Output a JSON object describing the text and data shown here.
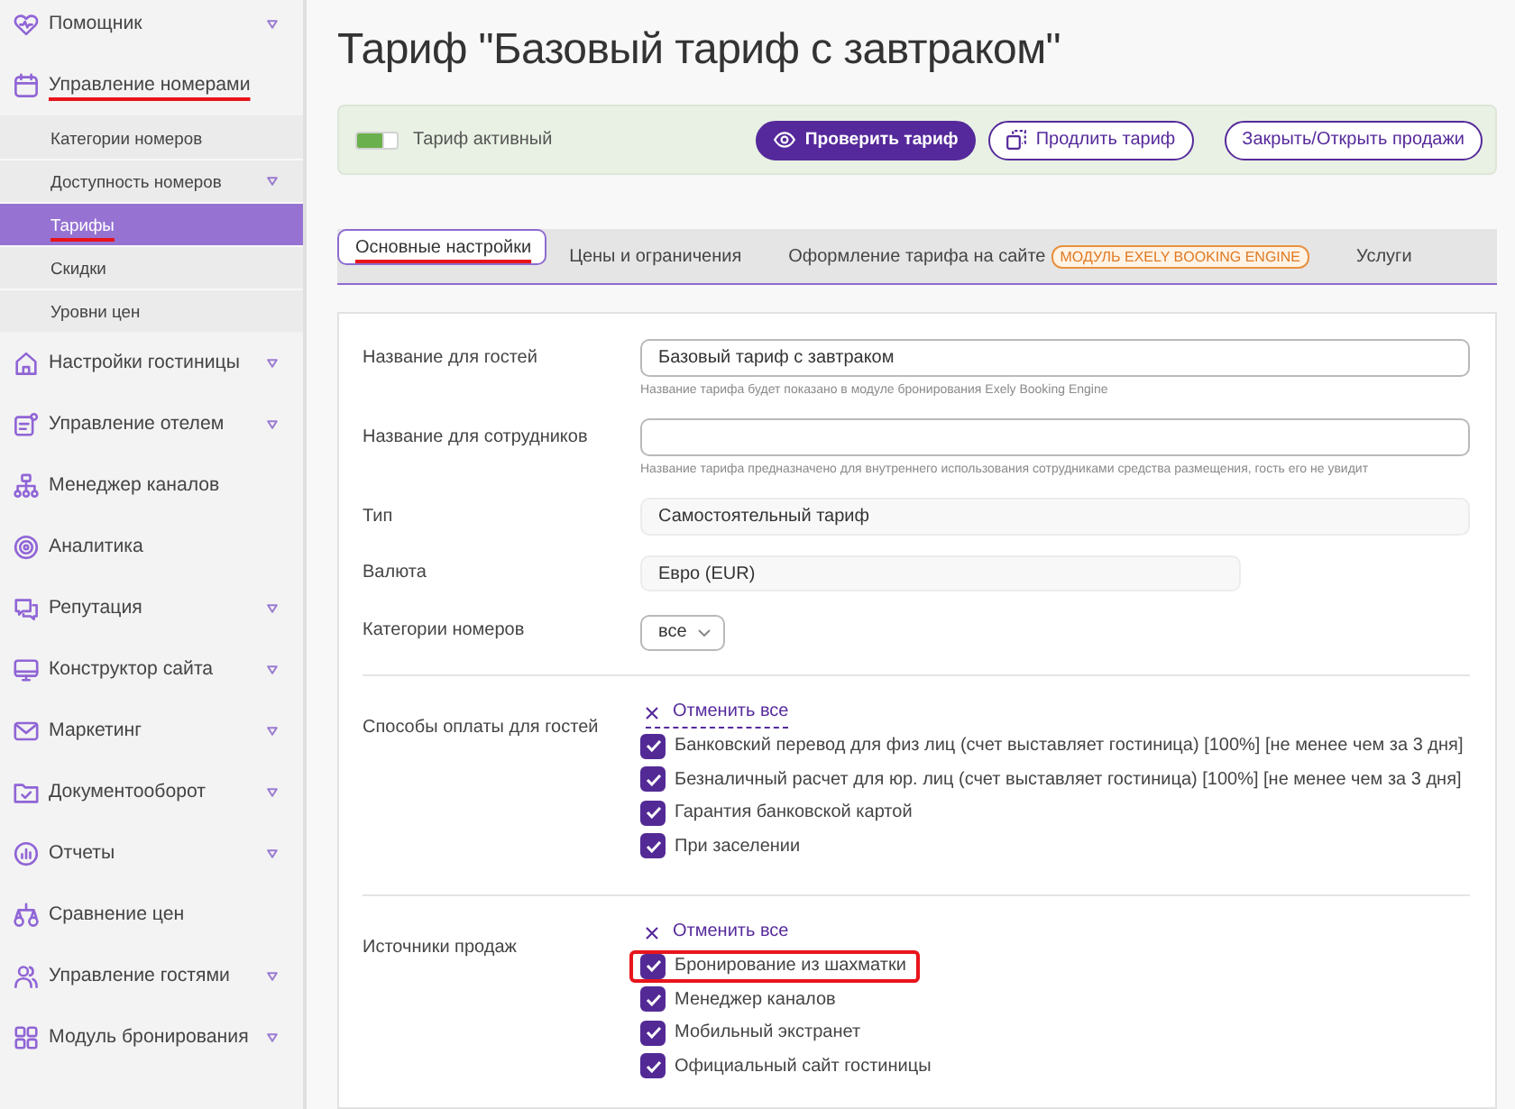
{
  "sidebar": {
    "items": [
      {
        "label": "Помощник",
        "caret": true,
        "highlighted": false
      },
      {
        "label": "Управление номерами",
        "caret": false,
        "highlighted": true,
        "children": [
          {
            "label": "Категории номеров",
            "caret": false,
            "selected": false,
            "highlighted": false
          },
          {
            "label": "Доступность номеров",
            "caret": true,
            "selected": false,
            "highlighted": false
          },
          {
            "label": "Тарифы",
            "caret": false,
            "selected": true,
            "highlighted": true
          },
          {
            "label": "Скидки",
            "caret": false,
            "selected": false,
            "highlighted": false
          },
          {
            "label": "Уровни цен",
            "caret": false,
            "selected": false,
            "highlighted": false
          }
        ]
      },
      {
        "label": "Настройки гостиницы",
        "caret": true,
        "highlighted": false
      },
      {
        "label": "Управление отелем",
        "caret": true,
        "highlighted": false
      },
      {
        "label": "Менеджер каналов",
        "caret": false,
        "highlighted": false
      },
      {
        "label": "Аналитика",
        "caret": false,
        "highlighted": false
      },
      {
        "label": "Репутация",
        "caret": true,
        "highlighted": false
      },
      {
        "label": "Конструктор сайта",
        "caret": true,
        "highlighted": false
      },
      {
        "label": "Маркетинг",
        "caret": true,
        "highlighted": false
      },
      {
        "label": "Документооборот",
        "caret": true,
        "highlighted": false
      },
      {
        "label": "Отчеты",
        "caret": true,
        "highlighted": false
      },
      {
        "label": "Сравнение цен",
        "caret": false,
        "highlighted": false
      },
      {
        "label": "Управление гостями",
        "caret": true,
        "highlighted": false
      },
      {
        "label": "Модуль бронирования",
        "caret": true,
        "highlighted": false
      }
    ]
  },
  "page": {
    "title": "Тариф \"Базовый тариф с завтраком\""
  },
  "action_bar": {
    "toggle": {
      "label": "Тариф активный",
      "on": true
    },
    "buttons": [
      {
        "label": "Проверить тариф",
        "kind": "primary"
      },
      {
        "label": "Продлить тариф",
        "kind": "outline"
      },
      {
        "label": "Закрыть/Открыть продажи",
        "kind": "outline"
      }
    ]
  },
  "tabs": [
    {
      "label": "Основные настройки",
      "selected": true,
      "highlighted": true
    },
    {
      "label": "Цены и ограничения",
      "selected": false,
      "highlighted": false
    },
    {
      "label": "Оформление тарифа на сайте",
      "badge": "МОДУЛЬ EXELY BOOKING ENGINE",
      "selected": false,
      "highlighted": false
    },
    {
      "label": "Услуги",
      "selected": false,
      "highlighted": false
    }
  ],
  "form": {
    "fields": [
      {
        "kind": "input",
        "label": "Название для гостей",
        "value": "Базовый тариф с завтраком",
        "hint": "Название тарифа будет показано в модуле бронирования Exely Booking Engine"
      },
      {
        "kind": "input",
        "label": "Название для сотрудников",
        "hint": "Название тарифа предназначено для внутреннего использования сотрудниками средства размещения, гость его не увидит"
      },
      {
        "kind": "display",
        "label": "Тип",
        "value": "Самостоятельный тариф"
      },
      {
        "kind": "compact",
        "label": "Валюта",
        "value": "Евро (EUR)"
      },
      {
        "kind": "select",
        "label": "Категории номеров",
        "value": "все"
      }
    ],
    "sections": [
      {
        "label": "Способы оплаты для гостей",
        "cancel_all": {
          "label": "Отменить все",
          "focused": true
        },
        "options": [
          {
            "label": "Банковский перевод для физ лиц (счет выставляет гостиница) [100%] [не менее чем за 3 дня]",
            "checked": true,
            "highlighted": false
          },
          {
            "label": "Безналичный расчет для юр. лиц (счет выставляет гостиница) [100%] [не менее чем за 3 дня]",
            "checked": true,
            "highlighted": false
          },
          {
            "label": "Гарантия банковской картой",
            "checked": true,
            "highlighted": false
          },
          {
            "label": "При заселении",
            "checked": true,
            "highlighted": false
          }
        ]
      },
      {
        "label": "Источники продаж",
        "cancel_all": {
          "label": "Отменить все",
          "focused": false
        },
        "options": [
          {
            "label": "Бронирование из шахматки",
            "checked": true,
            "highlighted": true
          },
          {
            "label": "Менеджер каналов",
            "checked": true,
            "highlighted": false
          },
          {
            "label": "Мобильный экстранет",
            "checked": true,
            "highlighted": false
          },
          {
            "label": "Официальный сайт гостиницы",
            "checked": true,
            "highlighted": false
          }
        ]
      }
    ]
  }
}
